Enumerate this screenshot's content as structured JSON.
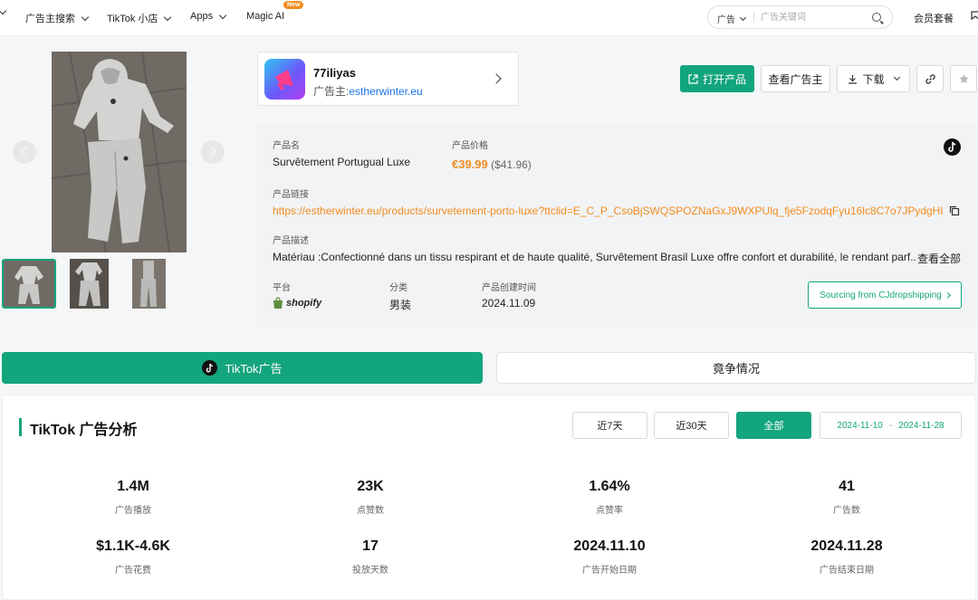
{
  "nav": {
    "items": [
      "广告主搜索",
      "TikTok 小店",
      "Apps",
      "Magic AI"
    ],
    "new_badge": "New",
    "search_type": "广告",
    "search_placeholder": "广告关键词",
    "member": "会员套餐"
  },
  "advertiser": {
    "name": "77iliyas",
    "sub_label": "广告主:",
    "domain": "estherwinter.eu"
  },
  "actions": {
    "open_product": "打开产品",
    "view_advertiser": "查看广告主",
    "download": "下载"
  },
  "product": {
    "name_label": "产品名",
    "name": "Survêtement Portugual Luxe",
    "price_label": "产品价格",
    "price": "€39.99",
    "price_original": "($41.96)",
    "link_label": "产品链接",
    "link": "https://estherwinter.eu/products/survetement-porto-luxe?ttclid=E_C_P_CsoBjSWQSPOZNaGxJ9WXPUlq_fje5FzodqFyu16lc8C7o7JPydgHLml...",
    "desc_label": "产品描述",
    "description": "Matériau :Confectionné dans un tissu respirant et de haute qualité, Survêtement Brasil Luxe offre confort et durabilité, le rendant parf...",
    "view_all": "查看全部",
    "platform_label": "平台",
    "platform": "shopify",
    "category_label": "分类",
    "category": "男装",
    "created_label": "产品创建时间",
    "created": "2024.11.09",
    "sourcing": "Sourcing from CJdropshipping"
  },
  "tabs": {
    "tiktok": "TikTok广告",
    "competition": "竟争情况"
  },
  "analysis": {
    "title": "TikTok 广告分析",
    "range_7": "近7天",
    "range_30": "近30天",
    "range_all": "全部",
    "date_start": "2024-11-10",
    "date_sep": "-",
    "date_end": "2024-11-28",
    "stats": [
      {
        "value": "1.4M",
        "label": "广告播放"
      },
      {
        "value": "23K",
        "label": "点赞数"
      },
      {
        "value": "1.64%",
        "label": "点赞率"
      },
      {
        "value": "41",
        "label": "广告数"
      },
      {
        "value": "$1.1K-4.6K",
        "label": "广告花费"
      },
      {
        "value": "17",
        "label": "投放天数"
      },
      {
        "value": "2024.11.10",
        "label": "广告开始日期"
      },
      {
        "value": "2024.11.28",
        "label": "广告结束日期"
      }
    ]
  },
  "colors": {
    "accent": "#13a57d",
    "price": "#f28b1f",
    "link": "#1a73e8"
  }
}
